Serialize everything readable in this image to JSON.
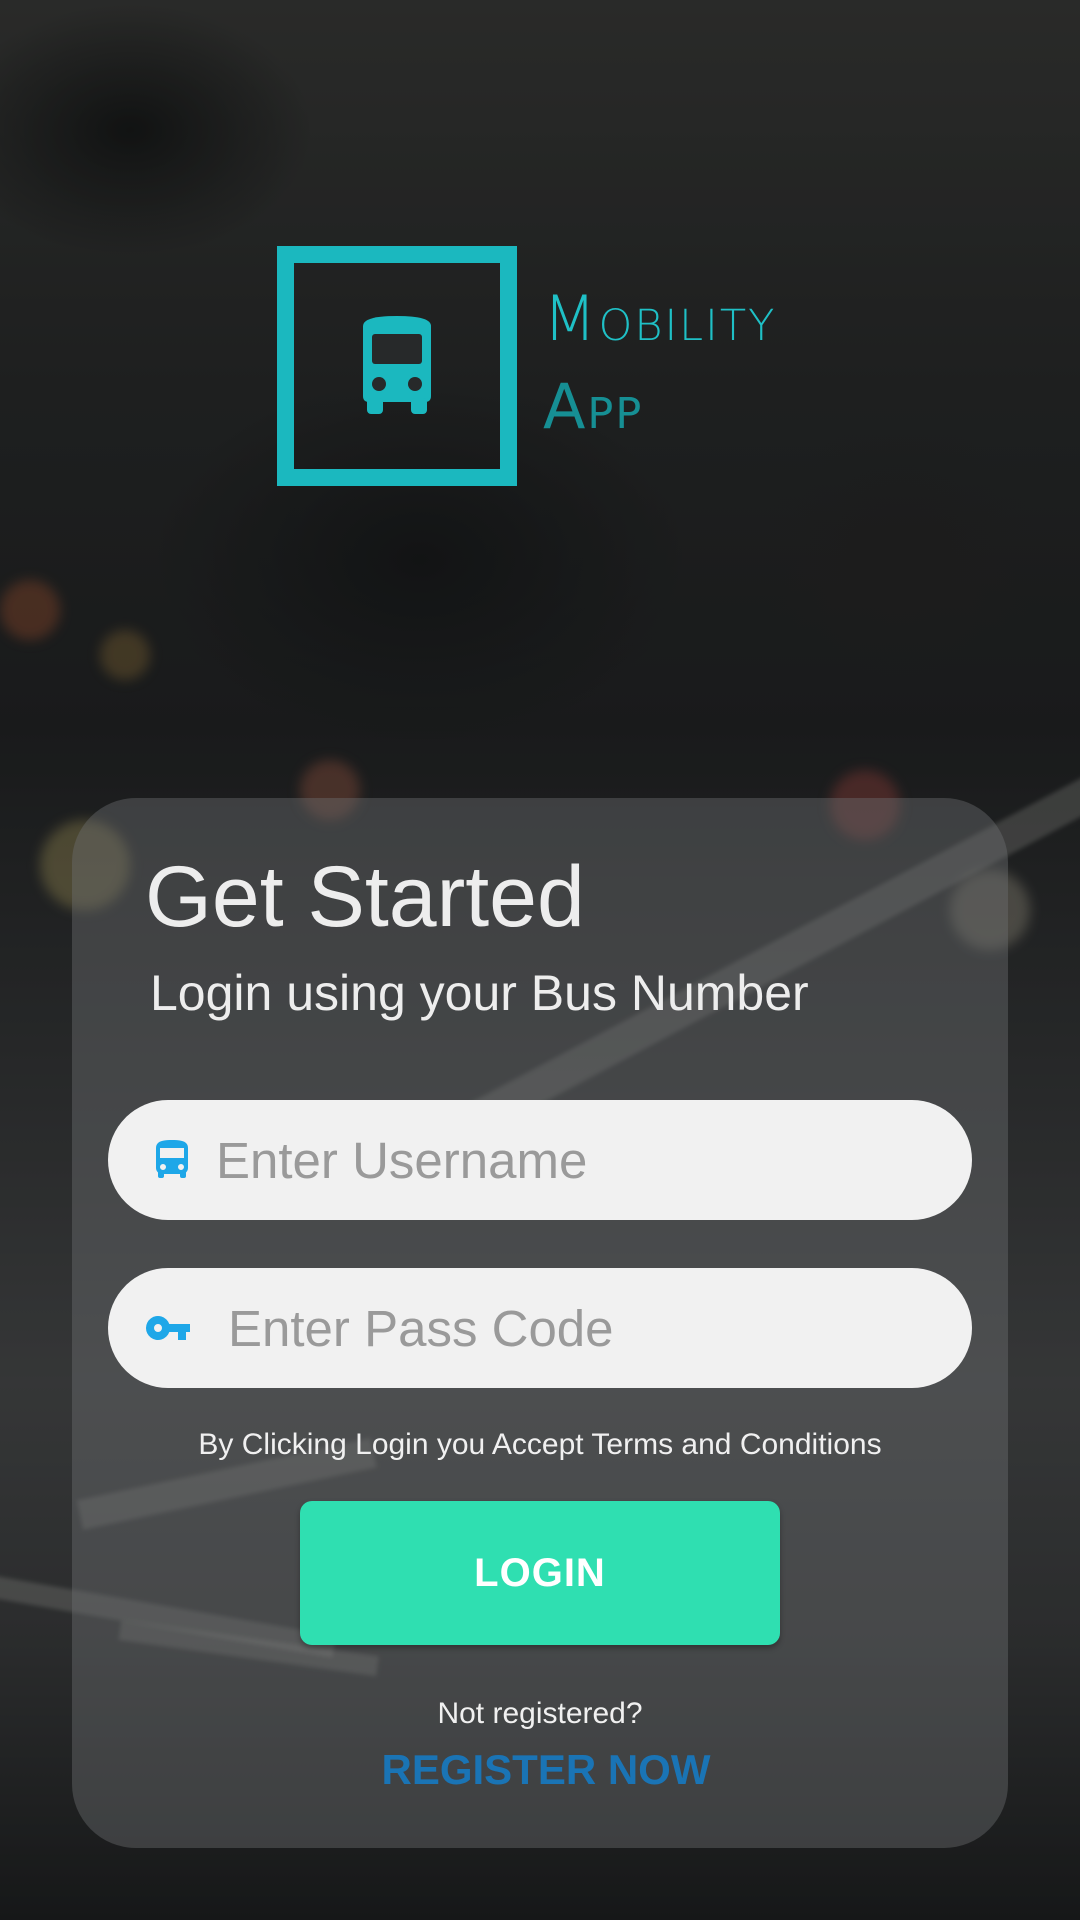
{
  "logo": {
    "line1": "Mobility",
    "line2": "App",
    "icon": "bus-icon"
  },
  "login_card": {
    "title": "Get Started",
    "subtitle": "Login using your Bus Number",
    "username": {
      "placeholder": "Enter Username",
      "value": "",
      "icon": "bus-icon"
    },
    "passcode": {
      "placeholder": "Enter Pass Code",
      "value": "",
      "icon": "key-icon"
    },
    "terms": "By Clicking Login you Accept Terms and Conditions",
    "login_label": "LOGIN",
    "not_registered": "Not registered?",
    "register_label": "REGISTER NOW"
  },
  "colors": {
    "accent_teal": "#1bb8bf",
    "button_green": "#2fdfb1",
    "link_blue": "#1a74b5",
    "field_icon_blue": "#1ea7e8"
  }
}
